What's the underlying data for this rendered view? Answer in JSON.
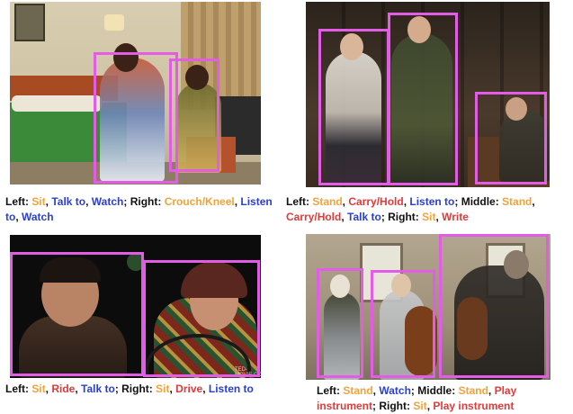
{
  "colors": {
    "box": "#e35ce6",
    "posture": "#f2a23a",
    "object": "#e03a3a",
    "person": "#2a3fd1",
    "text": "#111111"
  },
  "panels": [
    {
      "id": "bedroom",
      "caption": [
        {
          "t": "Left: ",
          "c": "text"
        },
        {
          "t": "Sit",
          "c": "posture"
        },
        {
          "t": ", ",
          "c": "text"
        },
        {
          "t": "Talk to",
          "c": "person"
        },
        {
          "t": ", ",
          "c": "text"
        },
        {
          "t": "Watch",
          "c": "person"
        },
        {
          "t": "; Right: ",
          "c": "text"
        },
        {
          "t": "Crouch/Kneel",
          "c": "posture"
        },
        {
          "t": ", ",
          "c": "text"
        },
        {
          "t": "Listen to",
          "c": "person"
        },
        {
          "t": ", ",
          "c": "text"
        },
        {
          "t": "Watch",
          "c": "person"
        }
      ]
    },
    {
      "id": "study",
      "caption": [
        {
          "t": "Left: ",
          "c": "text"
        },
        {
          "t": "Stand",
          "c": "posture"
        },
        {
          "t": ", ",
          "c": "text"
        },
        {
          "t": "Carry/Hold",
          "c": "object"
        },
        {
          "t": ", ",
          "c": "text"
        },
        {
          "t": "Listen to",
          "c": "person"
        },
        {
          "t": "; Middle: ",
          "c": "text"
        },
        {
          "t": "Stand",
          "c": "posture"
        },
        {
          "t": ", ",
          "c": "text"
        },
        {
          "t": "Carry/Hold",
          "c": "object"
        },
        {
          "t": ", ",
          "c": "text"
        },
        {
          "t": "Talk to",
          "c": "person"
        },
        {
          "t": "; Right: ",
          "c": "text"
        },
        {
          "t": "Sit",
          "c": "posture"
        },
        {
          "t": ", ",
          "c": "text"
        },
        {
          "t": "Write",
          "c": "object"
        }
      ]
    },
    {
      "id": "car",
      "watermark": "TED-MOVIE.CO",
      "caption": [
        {
          "t": "Left: ",
          "c": "text"
        },
        {
          "t": "Sit",
          "c": "posture"
        },
        {
          "t": ", ",
          "c": "text"
        },
        {
          "t": "Ride",
          "c": "object"
        },
        {
          "t": ", ",
          "c": "text"
        },
        {
          "t": "Talk to",
          "c": "person"
        },
        {
          "t": "; Right: ",
          "c": "text"
        },
        {
          "t": "Sit",
          "c": "posture"
        },
        {
          "t": ", ",
          "c": "text"
        },
        {
          "t": "Drive",
          "c": "object"
        },
        {
          "t": ", ",
          "c": "text"
        },
        {
          "t": "Listen to",
          "c": "person"
        }
      ]
    },
    {
      "id": "music",
      "caption": [
        {
          "t": "Left: ",
          "c": "text"
        },
        {
          "t": "Stand",
          "c": "posture"
        },
        {
          "t": ", ",
          "c": "text"
        },
        {
          "t": "Watch",
          "c": "person"
        },
        {
          "t": "; Middle: ",
          "c": "text"
        },
        {
          "t": "Stand",
          "c": "posture"
        },
        {
          "t": ", ",
          "c": "text"
        },
        {
          "t": "Play instrument",
          "c": "object"
        },
        {
          "t": "; Right: ",
          "c": "text"
        },
        {
          "t": "Sit",
          "c": "posture"
        },
        {
          "t": ", ",
          "c": "text"
        },
        {
          "t": "Play instrument",
          "c": "object"
        }
      ]
    }
  ]
}
